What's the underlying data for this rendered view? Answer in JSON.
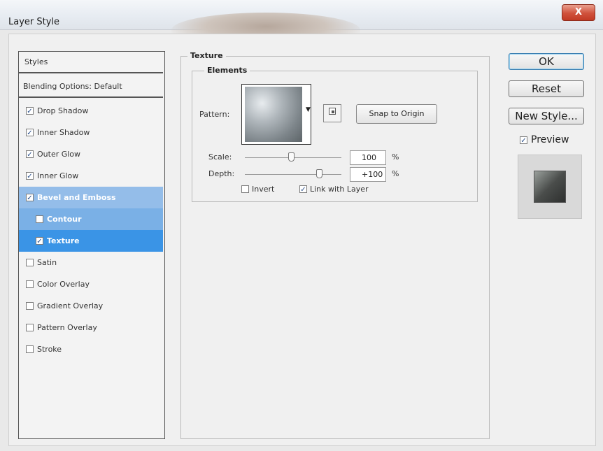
{
  "window": {
    "title": "Layer Style",
    "close_label": "X"
  },
  "styles_panel": {
    "header": "Styles",
    "blending": "Blending Options: Default",
    "items": [
      {
        "label": "Drop Shadow",
        "checked": true
      },
      {
        "label": "Inner Shadow",
        "checked": true
      },
      {
        "label": "Outer Glow",
        "checked": true
      },
      {
        "label": "Inner Glow",
        "checked": true
      },
      {
        "label": "Bevel and Emboss",
        "checked": true
      },
      {
        "label": "Contour",
        "checked": false
      },
      {
        "label": "Texture",
        "checked": true
      },
      {
        "label": "Satin",
        "checked": false
      },
      {
        "label": "Color Overlay",
        "checked": false
      },
      {
        "label": "Gradient Overlay",
        "checked": false
      },
      {
        "label": "Pattern Overlay",
        "checked": false
      },
      {
        "label": "Stroke",
        "checked": false
      }
    ]
  },
  "texture": {
    "group_title": "Texture",
    "elements_title": "Elements",
    "pattern_label": "Pattern:",
    "snap_label": "Snap to Origin",
    "scale_label": "Scale:",
    "scale_value": "100",
    "depth_label": "Depth:",
    "depth_value": "+100",
    "percent": "%",
    "invert_label": "Invert",
    "invert_checked": false,
    "link_label": "Link with Layer",
    "link_checked": true
  },
  "buttons": {
    "ok": "OK",
    "reset": "Reset",
    "new_style": "New Style...",
    "preview": "Preview",
    "preview_checked": true
  },
  "icons": {
    "check": "✓",
    "dropdown": "▼",
    "new_pattern": "new-preset-icon"
  }
}
